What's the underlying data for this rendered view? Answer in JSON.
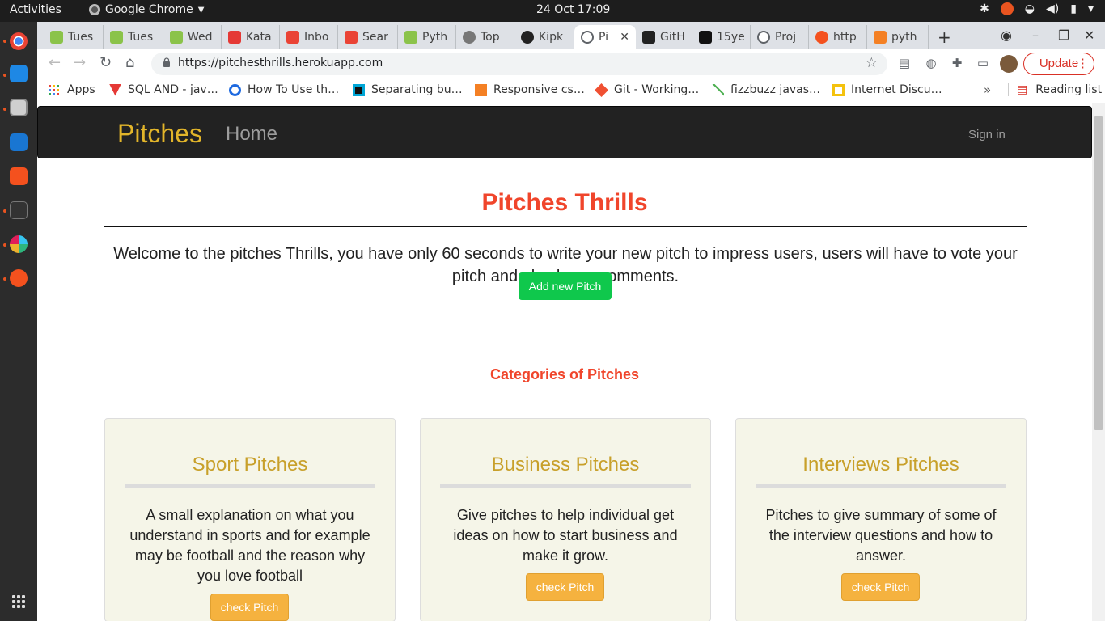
{
  "desktop": {
    "activities": "Activities",
    "app_name": "Google Chrome",
    "clock": "24 Oct  17:09"
  },
  "browser": {
    "tabs": [
      {
        "label": "Tues",
        "color": "#8bc34a"
      },
      {
        "label": "Tues",
        "color": "#8bc34a"
      },
      {
        "label": "Wed",
        "color": "#8bc34a"
      },
      {
        "label": "Kata",
        "color": "#e53935"
      },
      {
        "label": "Inbo",
        "color": "#ea4335"
      },
      {
        "label": "Sear",
        "color": "#ea4335"
      },
      {
        "label": "Pyth",
        "color": "#8bc34a"
      },
      {
        "label": "Top",
        "color": "#777777"
      },
      {
        "label": "Kipk",
        "color": "#222222"
      },
      {
        "label": "Pi",
        "color": "#5f6368"
      },
      {
        "label": "GitH",
        "color": "#222222"
      },
      {
        "label": "15ye",
        "color": "#111111"
      },
      {
        "label": "Proj",
        "color": "#5f6368"
      },
      {
        "label": "http",
        "color": "#f4511e"
      },
      {
        "label": "pyth",
        "color": "#f48024"
      }
    ],
    "url": "https://pitchesthrills.herokuapp.com",
    "update_label": "Update",
    "bookmarks": [
      {
        "label": "Apps"
      },
      {
        "label": "SQL AND - jav…",
        "color": "#e53935"
      },
      {
        "label": "How To Use th…",
        "color": "#1e6ae0"
      },
      {
        "label": "Separating bu…",
        "color": "#00a6d6"
      },
      {
        "label": "Responsive cs…",
        "color": "#f48024"
      },
      {
        "label": "Git - Working…",
        "color": "#f05032"
      },
      {
        "label": "fizzbuzz javas…",
        "color": "#4caf50"
      },
      {
        "label": "Internet Discu…",
        "color": "#f4c20d"
      }
    ],
    "reading_list": "Reading list"
  },
  "page": {
    "brand": "Pitches",
    "nav_home": "Home",
    "nav_signin": "Sign in",
    "title": "Pitches Thrills",
    "welcome_text": "Welcome to the pitches Thrills, you have only 60 seconds to write your new pitch to impress users, users will have to vote your pitch and also leave comments.",
    "add_button": "Add new Pitch",
    "categories_heading": "Categories of Pitches",
    "categories": [
      {
        "title": "Sport Pitches",
        "text": "A small explanation on what you understand in sports and for example may be football and the reason why you love football",
        "button": "check Pitch"
      },
      {
        "title": "Business Pitches",
        "text": "Give pitches to help individual get ideas on how to start business and make it grow.",
        "button": "check Pitch"
      },
      {
        "title": "Interviews Pitches",
        "text": "Pitches to give summary of some of the interview questions and how to answer.",
        "button": "check Pitch"
      }
    ]
  },
  "colors": {
    "brand_gold": "#e2b52a",
    "accent_red": "#f0452b",
    "add_green": "#0fc84c",
    "button_orange": "#f5b23f"
  }
}
